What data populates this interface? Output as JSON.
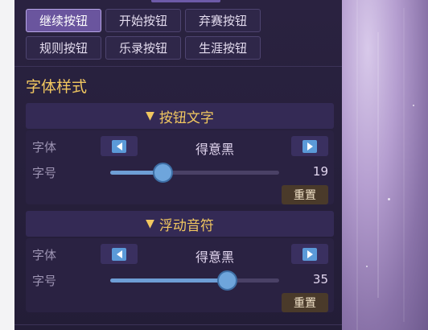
{
  "buttons": {
    "row1": [
      "继续按钮",
      "开始按钮",
      "弃赛按钮"
    ],
    "row2": [
      "规则按钮",
      "乐录按钮",
      "生涯按钮"
    ],
    "active": "继续按钮"
  },
  "section_title": "字体样式",
  "groups": [
    {
      "header": "按钮文字",
      "font_label": "字体",
      "font_value": "得意黑",
      "size_label": "字号",
      "size_value": "19",
      "slider_fraction": 0.31,
      "reset_label": "重置"
    },
    {
      "header": "浮动音符",
      "font_label": "字体",
      "font_value": "得意黑",
      "size_label": "字号",
      "size_value": "35",
      "slider_fraction": 0.69,
      "reset_label": "重置"
    }
  ],
  "colors": {
    "accent_gold": "#f1c760",
    "slider_blue": "#6e9ed6",
    "panel_bg": "#2a2240"
  },
  "icons": {
    "header_arrow": "triangle-down-icon",
    "prev": "arrow-left-icon",
    "next": "arrow-right-icon"
  }
}
